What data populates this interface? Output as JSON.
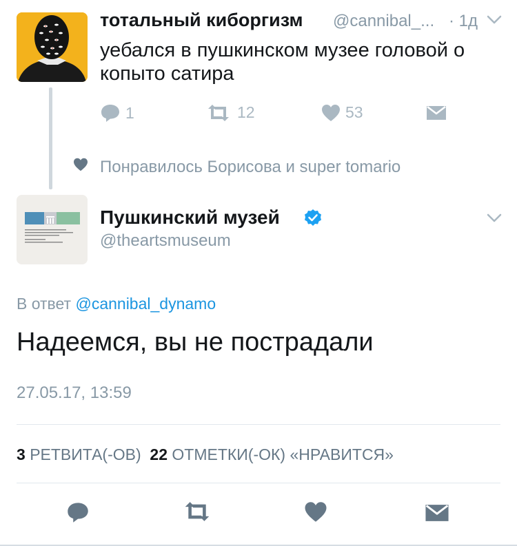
{
  "reply_tweet": {
    "display_name": "тотальный киборгизм",
    "handle": "@cannibal_...",
    "time": "· 1д",
    "text": "уебался в пушкинском музее головой о копыто сатира",
    "actions": {
      "reply_count": "1",
      "retweet_count": "12",
      "like_count": "53"
    },
    "liked_by": "Понравилось Борисова и super tomario"
  },
  "main_tweet": {
    "display_name": "Пушкинский музей",
    "handle": "@theartsmuseum",
    "reply_prefix": "В ответ",
    "reply_mention": "@cannibal_dynamo",
    "text": "Надеемся, вы не пострадали",
    "datetime": "27.05.17, 13:59",
    "stats": {
      "retweets_count": "3",
      "retweets_label": "РЕТВИТА(-ОВ)",
      "likes_count": "22",
      "likes_label": "ОТМЕТКИ(-ОК) «НРАВИТСЯ»"
    }
  },
  "icons": {
    "reply": "reply-icon",
    "retweet": "retweet-icon",
    "like": "heart-icon",
    "dm": "envelope-icon",
    "more": "chevron-down-icon",
    "verified": "verified-badge-icon"
  },
  "colors": {
    "icon_gray": "#aab8c2",
    "meta_gray": "#8899a6",
    "link_blue": "#1b95e0",
    "action_dark": "#657786",
    "avatar_yellow": "#f3b21c"
  }
}
